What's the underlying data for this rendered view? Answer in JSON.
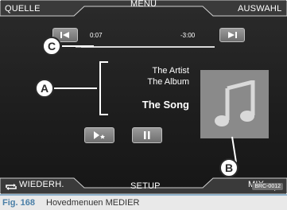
{
  "topbar": {
    "left": "QUELLE",
    "center": "MENÜ",
    "right": "AUSWAHL"
  },
  "player": {
    "elapsed": "0:07",
    "remaining": "-3:00",
    "progress": 0.04,
    "artist": "The Artist",
    "album": "The Album",
    "song": "The Song"
  },
  "controls": {
    "prev_icon": "skip-back-icon",
    "next_icon": "skip-forward-icon",
    "play_star_icon": "play-star-icon",
    "pause_icon": "pause-icon"
  },
  "bottombar": {
    "left": "WIEDERH.",
    "center": "SETUP",
    "right": "MIX"
  },
  "callouts": {
    "a": "A",
    "b": "B",
    "c": "C"
  },
  "caption": {
    "fig": "Fig. 168",
    "text": "Hovedmenuen MEDIER",
    "code": "BRC-0012"
  },
  "colors": {
    "screen": "#1d1d1d",
    "softkey": "#8a8a8a",
    "cover": "#8a8a8a",
    "caption_fig": "#4a7fa7"
  }
}
